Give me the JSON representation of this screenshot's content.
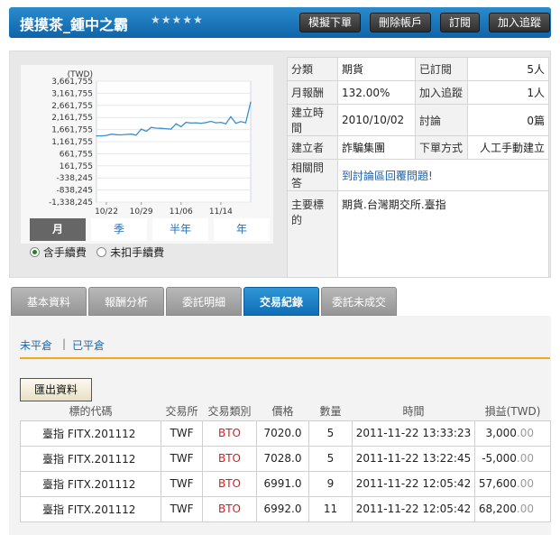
{
  "header": {
    "title": "摸摸茶_鍾中之霸",
    "stars": "★★★★★",
    "buttons": [
      "模擬下單",
      "刪除帳戶",
      "訂閱",
      "加入追蹤"
    ]
  },
  "chart_data": {
    "type": "line",
    "ylabel": "(TWD)",
    "y_ticks": [
      "3,661,755",
      "3,161,755",
      "2,661,755",
      "2,161,755",
      "1,661,755",
      "1,161,755",
      "661,755",
      "161,755",
      "-338,245",
      "-838,245",
      "-1,338,245"
    ],
    "y_tick_values": [
      3661755,
      3161755,
      2661755,
      2161755,
      1661755,
      1161755,
      661755,
      161755,
      -338245,
      -838245,
      -1338245
    ],
    "ylim": [
      -1338245,
      3661755
    ],
    "x_ticks": [
      "10/22",
      "10/29",
      "11/06",
      "11/14"
    ],
    "x_tick_index": [
      2,
      9,
      17,
      25
    ],
    "series": [
      {
        "values": [
          1400000,
          1400000,
          1420000,
          1470000,
          1450000,
          1440000,
          1460000,
          1470000,
          1430000,
          1680000,
          1590000,
          1750000,
          1720000,
          1710000,
          1700000,
          1680000,
          1900000,
          1780000,
          1960000,
          1930000,
          1940000,
          1920000,
          1950000,
          2000000,
          1940000,
          1960000,
          1900000,
          2190000,
          1920000,
          1990000,
          1940000,
          2800000
        ]
      }
    ],
    "grid": true
  },
  "periods": {
    "items": [
      "月",
      "季",
      "半年",
      "年"
    ],
    "active": 0
  },
  "fee_options": [
    "含手續費",
    "未扣手續費"
  ],
  "info": {
    "category_label": "分類",
    "category": "期貨",
    "subscribed_label": "已訂閱",
    "subscribed": "5人",
    "monthly_return_label": "月報酬",
    "monthly_return": "132.00%",
    "tracked_label": "加入追蹤",
    "tracked": "1人",
    "created_label": "建立時間",
    "created": "2010/10/02",
    "discuss_label": "討論",
    "discuss": "0篇",
    "creator_label": "建立者",
    "creator": "詐騙集團",
    "order_method_label": "下單方式",
    "order_method": "人工手動建立",
    "related_label": "相關問答",
    "related_link": "到討論區回覆問題!",
    "target_label": "主要標的",
    "target": "期貨.台灣期交所.臺指"
  },
  "tabs": {
    "items": [
      "基本資料",
      "報酬分析",
      "委託明細",
      "交易紀錄",
      "委託未成交"
    ],
    "active": 3
  },
  "subtabs": [
    "未平倉",
    "已平倉"
  ],
  "export_label": "匯出資料",
  "table": {
    "headers": [
      "標的代碼",
      "交易所",
      "交易類別",
      "價格",
      "數量",
      "時間",
      "損益(TWD)"
    ],
    "rows": [
      {
        "symbol": "臺指 FITX.201112",
        "exchange": "TWF",
        "type": "BTO",
        "price": "7020.0",
        "qty": "5",
        "time": "2011-11-22 13:33:23",
        "pl": "3,000",
        "pl_dec": ".00"
      },
      {
        "symbol": "臺指 FITX.201112",
        "exchange": "TWF",
        "type": "BTO",
        "price": "7028.0",
        "qty": "5",
        "time": "2011-11-22 13:22:45",
        "pl": "-5,000",
        "pl_dec": ".00"
      },
      {
        "symbol": "臺指 FITX.201112",
        "exchange": "TWF",
        "type": "BTO",
        "price": "6991.0",
        "qty": "9",
        "time": "2011-11-22 12:05:42",
        "pl": "57,600",
        "pl_dec": ".00"
      },
      {
        "symbol": "臺指 FITX.201112",
        "exchange": "TWF",
        "type": "BTO",
        "price": "6992.0",
        "qty": "11",
        "time": "2011-11-22 12:05:42",
        "pl": "68,200",
        "pl_dec": ".00"
      }
    ]
  }
}
